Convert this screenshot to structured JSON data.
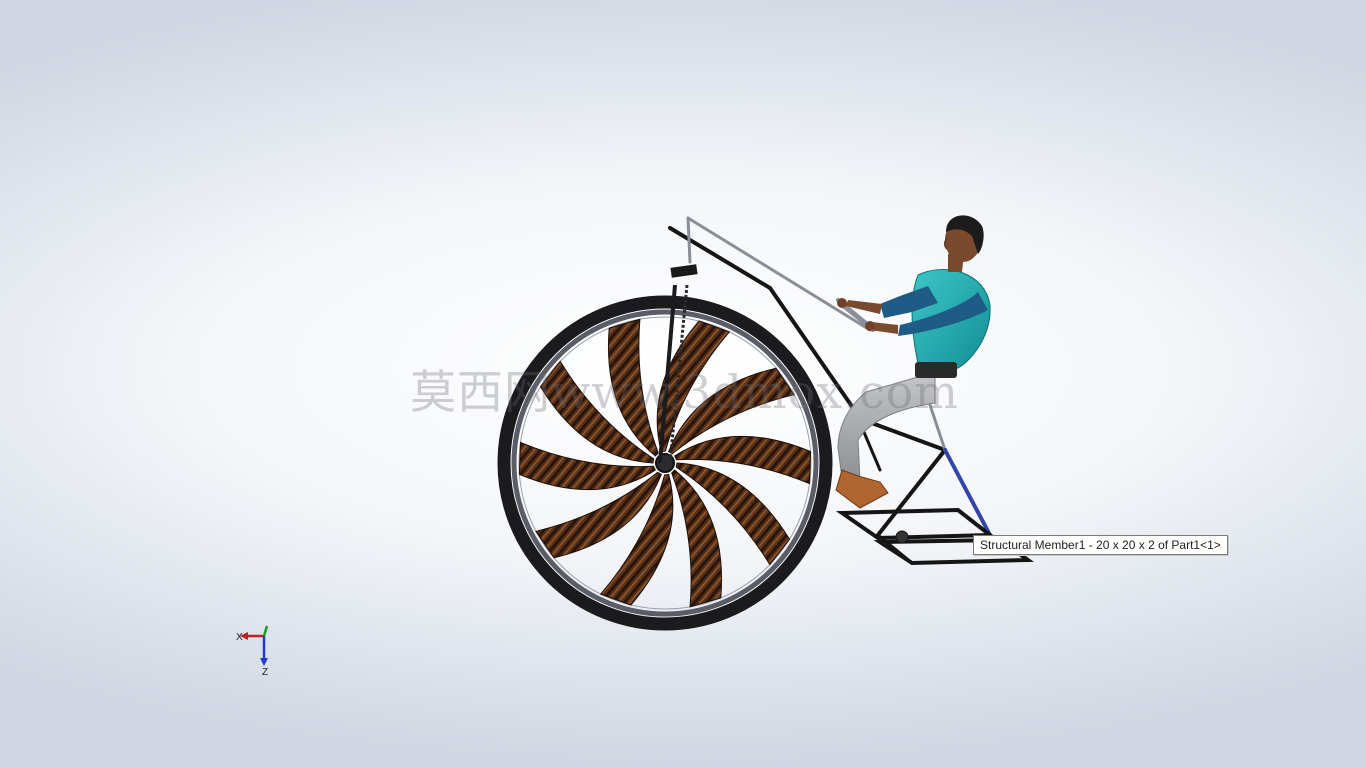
{
  "viewport": {
    "watermark": "莫西网www.3dmox.com",
    "tooltip": "Structural Member1 - 20 x 20 x 2 of Part1<1>"
  },
  "triad": {
    "x_label": "X",
    "z_label": "Z"
  },
  "colors": {
    "bg_center": "#ffffff",
    "bg_edge": "#cfd6e1",
    "tire": "#1b1b1d",
    "rim": "#5a5d66",
    "blade_wood": "#5b3118",
    "frame": "#151515",
    "frame_selected": "#3344aa",
    "shirt": "#1aa7ad",
    "sleeve": "#1e5c86",
    "pants": "#a7a9ad",
    "skin": "#7a4a2e",
    "shoe": "#b0652e"
  }
}
